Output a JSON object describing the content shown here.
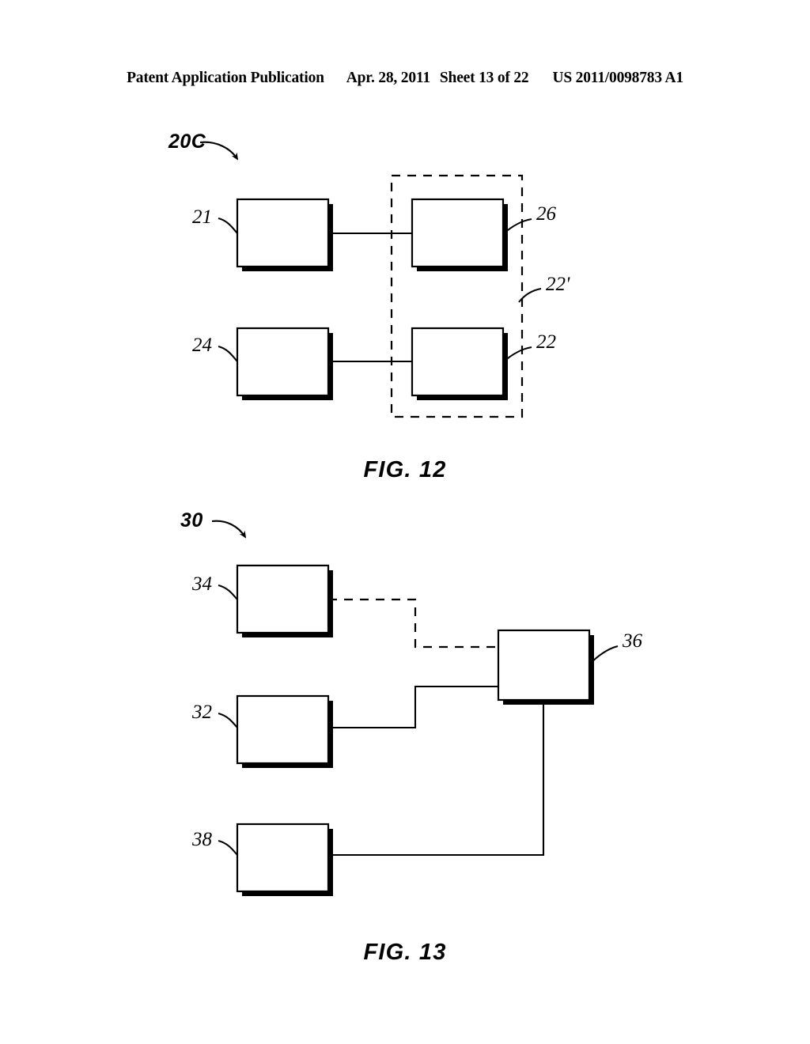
{
  "header": {
    "publication": "Patent Application Publication",
    "date": "Apr. 28, 2011",
    "sheet": "Sheet 13 of 22",
    "patent_number": "US 2011/0098783 A1"
  },
  "colors": {
    "ink": "#000000",
    "paper": "#ffffff"
  },
  "figures": [
    {
      "id": "fig-12",
      "caption": "FIG. 12",
      "system_label": "20C",
      "boxes": [
        {
          "ref": "21",
          "name": "box-21"
        },
        {
          "ref": "24",
          "name": "box-24"
        },
        {
          "ref": "26",
          "name": "box-26"
        },
        {
          "ref": "22",
          "name": "box-22"
        }
      ],
      "group_label": "22'",
      "labels": {
        "left_top": "21",
        "left_bottom": "24",
        "right_top": "26",
        "right_group": "22'",
        "right_bottom": "22"
      }
    },
    {
      "id": "fig-13",
      "caption": "FIG. 13",
      "system_label": "30",
      "boxes": [
        {
          "ref": "34",
          "name": "box-34"
        },
        {
          "ref": "32",
          "name": "box-32"
        },
        {
          "ref": "38",
          "name": "box-38"
        },
        {
          "ref": "36",
          "name": "box-36"
        }
      ],
      "labels": {
        "top_left": "34",
        "middle_left": "32",
        "bottom_left": "38",
        "right": "36"
      }
    }
  ]
}
